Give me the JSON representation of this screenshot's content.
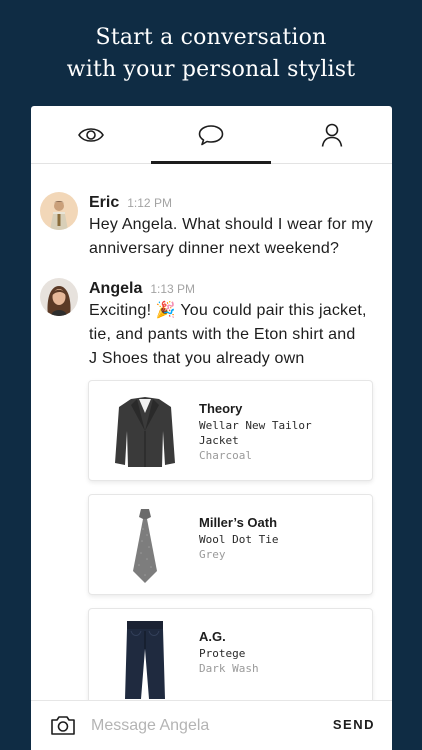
{
  "headline": {
    "line1": "Start a conversation",
    "line2": "with your personal stylist"
  },
  "tabs": [
    {
      "icon": "eye-icon",
      "active": false
    },
    {
      "icon": "chat-bubble-icon",
      "active": true
    },
    {
      "icon": "profile-icon",
      "active": false
    }
  ],
  "messages": [
    {
      "sender": "Eric",
      "time": "1:12 PM",
      "lines": [
        "Hey Angela. What should I wear for my",
        "anniversary dinner next weekend?"
      ]
    },
    {
      "sender": "Angela",
      "time": "1:13 PM",
      "lines": [
        "Exciting! 🎉 You could pair this jacket,",
        "tie, and pants with the Eton shirt and",
        "J Shoes that you already own"
      ]
    }
  ],
  "products": [
    {
      "brand": "Theory",
      "name_lines": [
        "Wellar New Tailor",
        "Jacket"
      ],
      "color": "Charcoal",
      "image": "jacket-image"
    },
    {
      "brand": "Miller’s Oath",
      "name_lines": [
        "Wool Dot Tie"
      ],
      "color": "Grey",
      "image": "tie-image"
    },
    {
      "brand": "A.G.",
      "name_lines": [
        "Protege"
      ],
      "color": "Dark Wash",
      "image": "jeans-image"
    }
  ],
  "composer": {
    "placeholder": "Message Angela",
    "value": "",
    "send_label": "SEND",
    "camera_icon": "camera-icon"
  },
  "colors": {
    "background": "#0f2c44",
    "card": "#ffffff",
    "text": "#1d1d1d",
    "muted": "#a3a3a3"
  }
}
